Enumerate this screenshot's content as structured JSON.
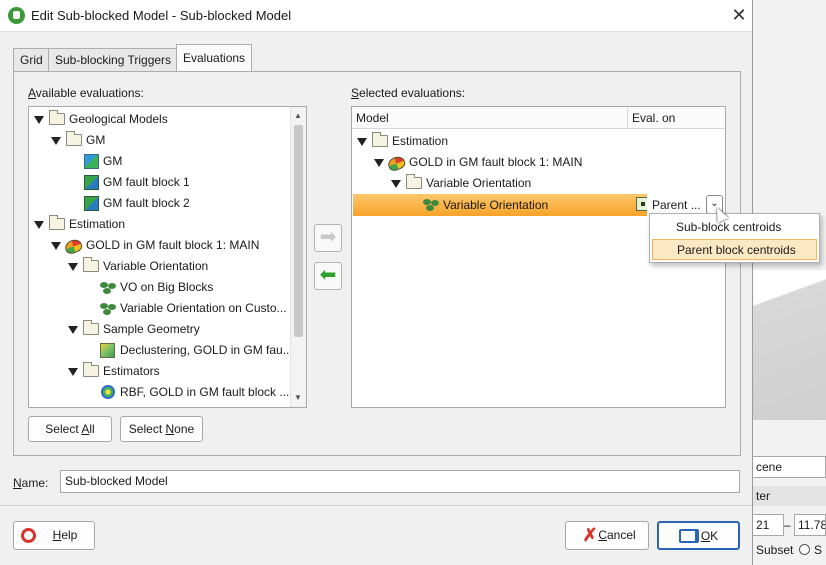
{
  "dialog": {
    "title": "Edit Sub-blocked Model - Sub-blocked Model",
    "icons": {
      "app": "leapfrog-app-icon",
      "close": "close-icon"
    },
    "close_glyph": "✕"
  },
  "tabs": [
    {
      "label": "Grid",
      "active": false
    },
    {
      "label": "Sub-blocking Triggers",
      "active": false
    },
    {
      "label": "Evaluations",
      "active": true
    }
  ],
  "available": {
    "label_prefix": "A",
    "label_rest": "vailable evaluations:",
    "items": [
      {
        "label": "Geological Models",
        "icon": "folder-icon",
        "expanded": true
      },
      {
        "label": "GM",
        "icon": "folder-icon",
        "expanded": true
      },
      {
        "label": "GM",
        "icon": "geological-model-icon"
      },
      {
        "label": "GM fault block 1",
        "icon": "fault-block-model-icon"
      },
      {
        "label": "GM fault block 2",
        "icon": "fault-block-model-icon"
      },
      {
        "label": "Estimation",
        "icon": "folder-icon",
        "expanded": true
      },
      {
        "label": "GOLD in GM fault block 1: MAIN",
        "icon": "domained-estimation-icon",
        "expanded": true
      },
      {
        "label": "Variable Orientation",
        "icon": "folder-icon",
        "expanded": true
      },
      {
        "label": "VO on Big Blocks",
        "icon": "variable-orientation-icon"
      },
      {
        "label": "Variable Orientation on Custo...",
        "icon": "variable-orientation-icon"
      },
      {
        "label": "Sample Geometry",
        "icon": "folder-icon",
        "expanded": true
      },
      {
        "label": "Declustering, GOLD in GM fau...",
        "icon": "declustering-icon"
      },
      {
        "label": "Estimators",
        "icon": "folder-icon",
        "expanded": true
      },
      {
        "label": "RBF, GOLD in GM fault block ...",
        "icon": "rbf-icon"
      }
    ],
    "select_all": {
      "pre": "Select ",
      "key": "A",
      "post": "ll"
    },
    "select_none": {
      "pre": "Select ",
      "key": "N",
      "post": "one"
    }
  },
  "transfer": {
    "add_icon": "arrow-right-icon",
    "remove_icon": "arrow-left-icon"
  },
  "selected": {
    "label_prefix": "S",
    "label_rest": "elected evaluations:",
    "columns": [
      "Model",
      "Eval. on"
    ],
    "items": [
      {
        "label": "Estimation",
        "icon": "folder-icon",
        "expanded": true
      },
      {
        "label": "GOLD in GM fault block 1: MAIN",
        "icon": "domained-estimation-icon",
        "expanded": true
      },
      {
        "label": "Variable Orientation",
        "icon": "folder-icon",
        "expanded": true
      },
      {
        "label": "Variable Orientation",
        "icon": "variable-orientation-icon",
        "selected": true,
        "eval_on": "Parent ..."
      }
    ],
    "dropdown_options": [
      "Sub-block centroids",
      "Parent block centroids"
    ],
    "dropdown_highlight": "Parent block centroids"
  },
  "name": {
    "label_key": "N",
    "label_rest": "ame:",
    "value": "Sub-blocked Model"
  },
  "footer": {
    "help": {
      "key": "H",
      "rest": "elp"
    },
    "cancel": {
      "key": "C",
      "rest": "ancel"
    },
    "ok": {
      "key": "O",
      "rest": "K"
    }
  },
  "background_app": {
    "scene": "cene",
    "filter": "ter",
    "field_a": "21",
    "field_sep": "–",
    "field_b": "11.78",
    "subset": "Subset",
    "option_s": "S"
  },
  "colors": {
    "selection": "#f6a329",
    "highlight": "#fde8c4",
    "accent": "#2a64b8"
  }
}
